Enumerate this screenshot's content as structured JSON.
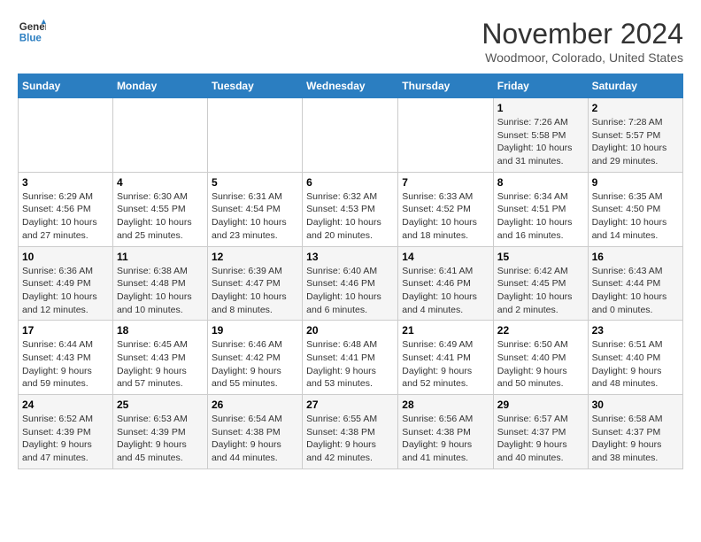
{
  "header": {
    "logo_line1": "General",
    "logo_line2": "Blue",
    "month": "November 2024",
    "location": "Woodmoor, Colorado, United States"
  },
  "days_of_week": [
    "Sunday",
    "Monday",
    "Tuesday",
    "Wednesday",
    "Thursday",
    "Friday",
    "Saturday"
  ],
  "weeks": [
    [
      {
        "day": "",
        "info": ""
      },
      {
        "day": "",
        "info": ""
      },
      {
        "day": "",
        "info": ""
      },
      {
        "day": "",
        "info": ""
      },
      {
        "day": "",
        "info": ""
      },
      {
        "day": "1",
        "info": "Sunrise: 7:26 AM\nSunset: 5:58 PM\nDaylight: 10 hours and 31 minutes."
      },
      {
        "day": "2",
        "info": "Sunrise: 7:28 AM\nSunset: 5:57 PM\nDaylight: 10 hours and 29 minutes."
      }
    ],
    [
      {
        "day": "3",
        "info": "Sunrise: 6:29 AM\nSunset: 4:56 PM\nDaylight: 10 hours and 27 minutes."
      },
      {
        "day": "4",
        "info": "Sunrise: 6:30 AM\nSunset: 4:55 PM\nDaylight: 10 hours and 25 minutes."
      },
      {
        "day": "5",
        "info": "Sunrise: 6:31 AM\nSunset: 4:54 PM\nDaylight: 10 hours and 23 minutes."
      },
      {
        "day": "6",
        "info": "Sunrise: 6:32 AM\nSunset: 4:53 PM\nDaylight: 10 hours and 20 minutes."
      },
      {
        "day": "7",
        "info": "Sunrise: 6:33 AM\nSunset: 4:52 PM\nDaylight: 10 hours and 18 minutes."
      },
      {
        "day": "8",
        "info": "Sunrise: 6:34 AM\nSunset: 4:51 PM\nDaylight: 10 hours and 16 minutes."
      },
      {
        "day": "9",
        "info": "Sunrise: 6:35 AM\nSunset: 4:50 PM\nDaylight: 10 hours and 14 minutes."
      }
    ],
    [
      {
        "day": "10",
        "info": "Sunrise: 6:36 AM\nSunset: 4:49 PM\nDaylight: 10 hours and 12 minutes."
      },
      {
        "day": "11",
        "info": "Sunrise: 6:38 AM\nSunset: 4:48 PM\nDaylight: 10 hours and 10 minutes."
      },
      {
        "day": "12",
        "info": "Sunrise: 6:39 AM\nSunset: 4:47 PM\nDaylight: 10 hours and 8 minutes."
      },
      {
        "day": "13",
        "info": "Sunrise: 6:40 AM\nSunset: 4:46 PM\nDaylight: 10 hours and 6 minutes."
      },
      {
        "day": "14",
        "info": "Sunrise: 6:41 AM\nSunset: 4:46 PM\nDaylight: 10 hours and 4 minutes."
      },
      {
        "day": "15",
        "info": "Sunrise: 6:42 AM\nSunset: 4:45 PM\nDaylight: 10 hours and 2 minutes."
      },
      {
        "day": "16",
        "info": "Sunrise: 6:43 AM\nSunset: 4:44 PM\nDaylight: 10 hours and 0 minutes."
      }
    ],
    [
      {
        "day": "17",
        "info": "Sunrise: 6:44 AM\nSunset: 4:43 PM\nDaylight: 9 hours and 59 minutes."
      },
      {
        "day": "18",
        "info": "Sunrise: 6:45 AM\nSunset: 4:43 PM\nDaylight: 9 hours and 57 minutes."
      },
      {
        "day": "19",
        "info": "Sunrise: 6:46 AM\nSunset: 4:42 PM\nDaylight: 9 hours and 55 minutes."
      },
      {
        "day": "20",
        "info": "Sunrise: 6:48 AM\nSunset: 4:41 PM\nDaylight: 9 hours and 53 minutes."
      },
      {
        "day": "21",
        "info": "Sunrise: 6:49 AM\nSunset: 4:41 PM\nDaylight: 9 hours and 52 minutes."
      },
      {
        "day": "22",
        "info": "Sunrise: 6:50 AM\nSunset: 4:40 PM\nDaylight: 9 hours and 50 minutes."
      },
      {
        "day": "23",
        "info": "Sunrise: 6:51 AM\nSunset: 4:40 PM\nDaylight: 9 hours and 48 minutes."
      }
    ],
    [
      {
        "day": "24",
        "info": "Sunrise: 6:52 AM\nSunset: 4:39 PM\nDaylight: 9 hours and 47 minutes."
      },
      {
        "day": "25",
        "info": "Sunrise: 6:53 AM\nSunset: 4:39 PM\nDaylight: 9 hours and 45 minutes."
      },
      {
        "day": "26",
        "info": "Sunrise: 6:54 AM\nSunset: 4:38 PM\nDaylight: 9 hours and 44 minutes."
      },
      {
        "day": "27",
        "info": "Sunrise: 6:55 AM\nSunset: 4:38 PM\nDaylight: 9 hours and 42 minutes."
      },
      {
        "day": "28",
        "info": "Sunrise: 6:56 AM\nSunset: 4:38 PM\nDaylight: 9 hours and 41 minutes."
      },
      {
        "day": "29",
        "info": "Sunrise: 6:57 AM\nSunset: 4:37 PM\nDaylight: 9 hours and 40 minutes."
      },
      {
        "day": "30",
        "info": "Sunrise: 6:58 AM\nSunset: 4:37 PM\nDaylight: 9 hours and 38 minutes."
      }
    ]
  ]
}
